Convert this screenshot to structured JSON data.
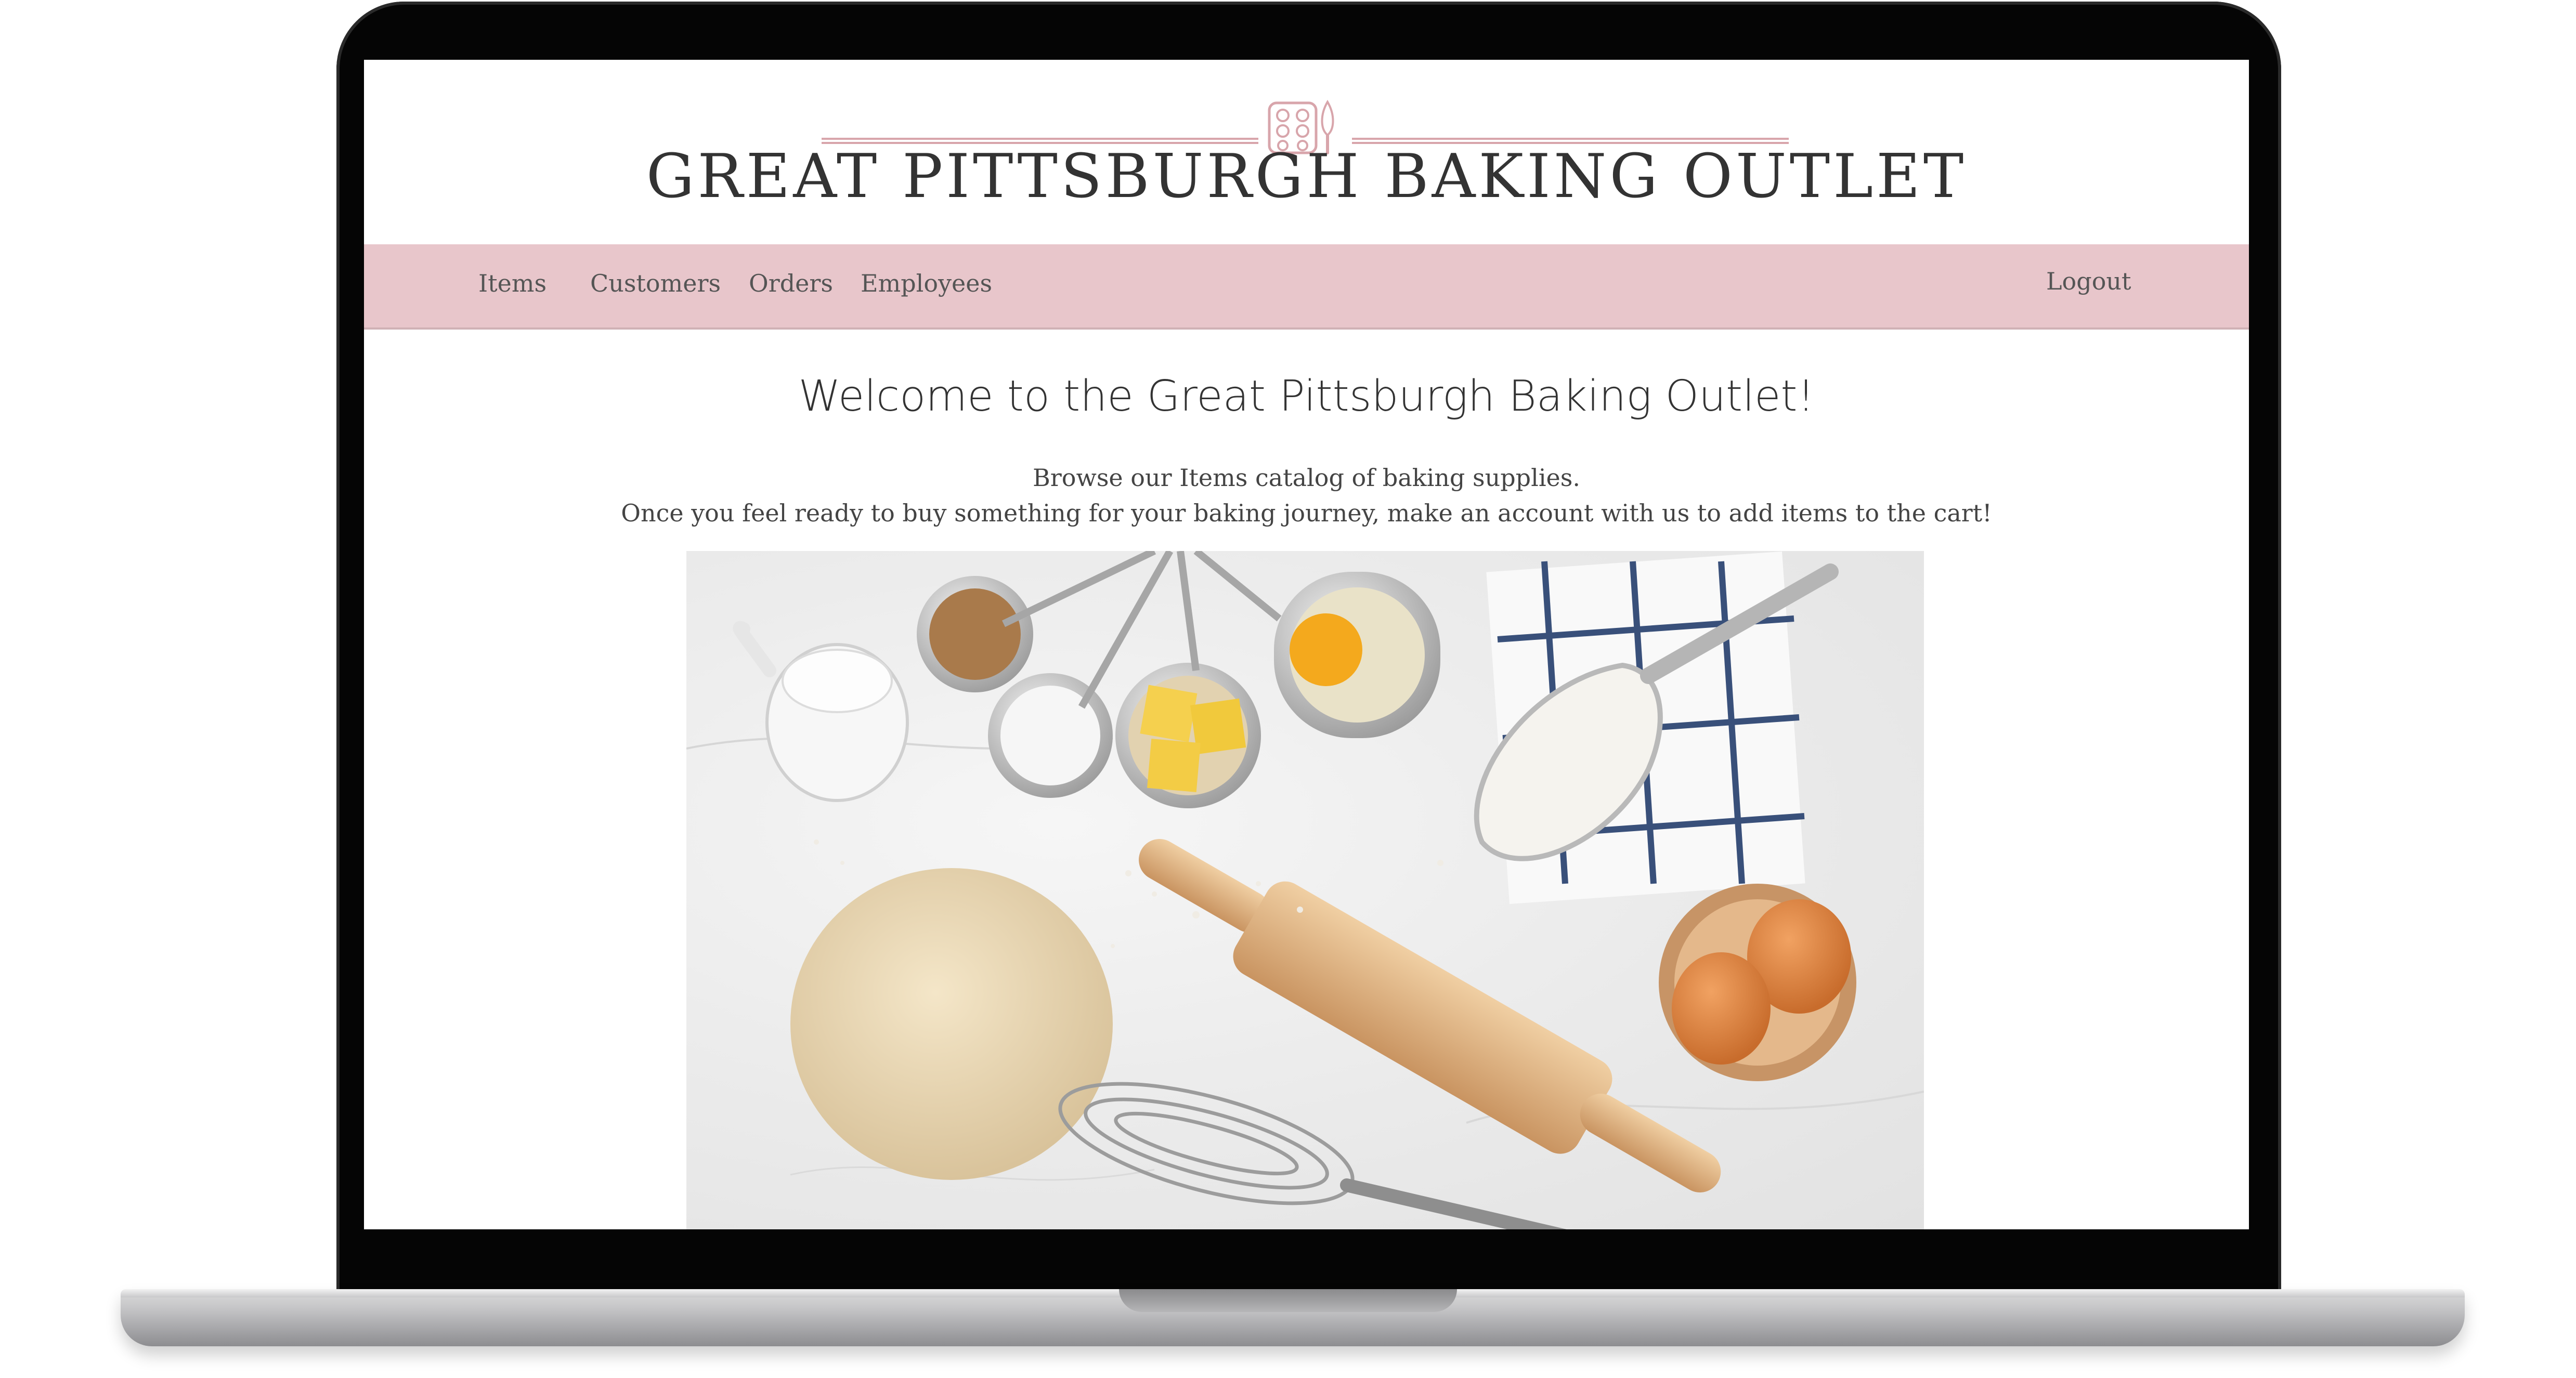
{
  "logo": {
    "title": "GREAT PITTSBURGH BAKING OUTLET",
    "icon": "muffin-tray-and-whisk-icon",
    "accent_color": "#d8a5ab"
  },
  "nav": {
    "background": "#e8c6cb",
    "items": [
      {
        "label": "Items"
      },
      {
        "label": "Customers"
      },
      {
        "label": "Orders"
      },
      {
        "label": "Employees"
      }
    ],
    "logout_label": "Logout"
  },
  "main": {
    "heading": "Welcome to the Great Pittsburgh Baking Outlet!",
    "intro_line_1": "Browse our Items catalog of baking supplies.",
    "intro_line_2": "Once you feel ready to buy something for your baking journey, make an account with us to add items to the cart!",
    "hero_image": "baking-ingredients-photo"
  }
}
